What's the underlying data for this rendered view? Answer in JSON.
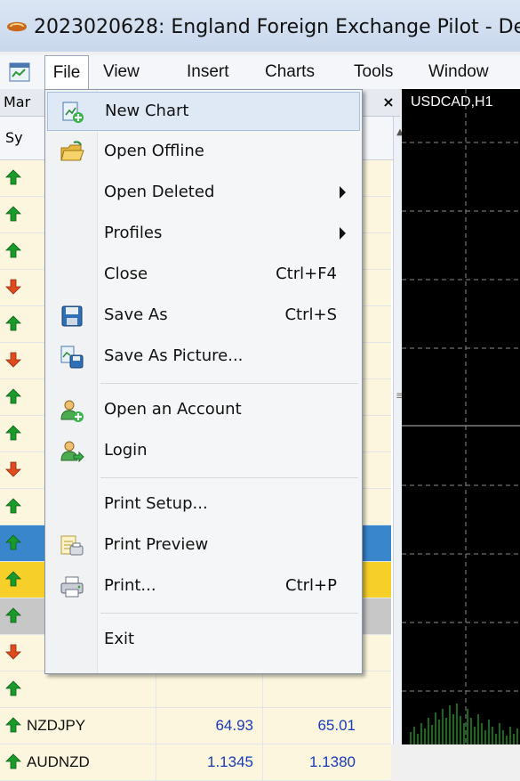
{
  "window": {
    "title": "2023020628: England Foreign Exchange Pilot - Der"
  },
  "menubar": {
    "items": [
      "File",
      "View",
      "Insert",
      "Charts",
      "Tools",
      "Window"
    ]
  },
  "market_watch": {
    "title": "Mar",
    "close_glyph": "×",
    "col_symbol": "Sy",
    "rows": [
      {
        "dir": "up",
        "symbol": "",
        "bid": "",
        "ask": "",
        "style": "alt"
      },
      {
        "dir": "up",
        "symbol": "",
        "bid": "",
        "ask": "",
        "style": "alt"
      },
      {
        "dir": "up",
        "symbol": "",
        "bid": "",
        "ask": "",
        "style": "alt"
      },
      {
        "dir": "down",
        "symbol": "",
        "bid": "",
        "ask": "",
        "style": "alt"
      },
      {
        "dir": "up",
        "symbol": "",
        "bid": "",
        "ask": "",
        "style": "alt"
      },
      {
        "dir": "down",
        "symbol": "",
        "bid": "",
        "ask": "",
        "style": "alt"
      },
      {
        "dir": "up",
        "symbol": "",
        "bid": "",
        "ask": "",
        "style": "alt"
      },
      {
        "dir": "up",
        "symbol": "",
        "bid": "",
        "ask": "",
        "style": "alt"
      },
      {
        "dir": "down",
        "symbol": "",
        "bid": "",
        "ask": "",
        "style": "alt"
      },
      {
        "dir": "up",
        "symbol": "",
        "bid": "",
        "ask": "",
        "style": "alt"
      },
      {
        "dir": "up",
        "symbol": "",
        "bid": "",
        "ask": "",
        "style": "sel"
      },
      {
        "dir": "up",
        "symbol": "",
        "bid": "",
        "ask": "",
        "style": "sel2"
      },
      {
        "dir": "up",
        "symbol": "",
        "bid": "",
        "ask": "",
        "style": "sel3"
      },
      {
        "dir": "down",
        "symbol": "",
        "bid": "",
        "ask": "",
        "style": "alt"
      },
      {
        "dir": "up",
        "symbol": "",
        "bid": "",
        "ask": "",
        "style": "alt"
      },
      {
        "dir": "up",
        "symbol": "NZDJPY",
        "bid": "64.93",
        "ask": "65.01",
        "style": "alt"
      },
      {
        "dir": "up",
        "symbol": "AUDNZD",
        "bid": "1.1345",
        "ask": "1.1380",
        "style": "alt"
      }
    ]
  },
  "chart": {
    "label": "USDCAD,H1"
  },
  "file_menu": {
    "items": [
      {
        "label": "New Chart",
        "shortcut": "",
        "submenu": false,
        "icon": "new-chart-icon",
        "highlight": true
      },
      {
        "label": "Open Offline",
        "shortcut": "",
        "submenu": false,
        "icon": "open-folder-icon"
      },
      {
        "label": "Open Deleted",
        "shortcut": "",
        "submenu": true,
        "icon": ""
      },
      {
        "label": "Profiles",
        "shortcut": "",
        "submenu": true,
        "icon": ""
      },
      {
        "label": "Close",
        "shortcut": "Ctrl+F4",
        "submenu": false,
        "icon": ""
      },
      {
        "label": "Save As",
        "shortcut": "Ctrl+S",
        "submenu": false,
        "icon": "floppy-disk-icon"
      },
      {
        "label": "Save As Picture...",
        "shortcut": "",
        "submenu": false,
        "icon": "save-picture-icon",
        "sep_after": true
      },
      {
        "label": "Open an Account",
        "shortcut": "",
        "submenu": false,
        "icon": "open-account-icon"
      },
      {
        "label": "Login",
        "shortcut": "",
        "submenu": false,
        "icon": "login-icon",
        "sep_after": true
      },
      {
        "label": "Print Setup...",
        "shortcut": "",
        "submenu": false,
        "icon": ""
      },
      {
        "label": "Print Preview",
        "shortcut": "",
        "submenu": false,
        "icon": "print-preview-icon"
      },
      {
        "label": "Print...",
        "shortcut": "Ctrl+P",
        "submenu": false,
        "icon": "printer-icon",
        "sep_after": true
      },
      {
        "label": "Exit",
        "shortcut": "",
        "submenu": false,
        "icon": ""
      }
    ]
  }
}
